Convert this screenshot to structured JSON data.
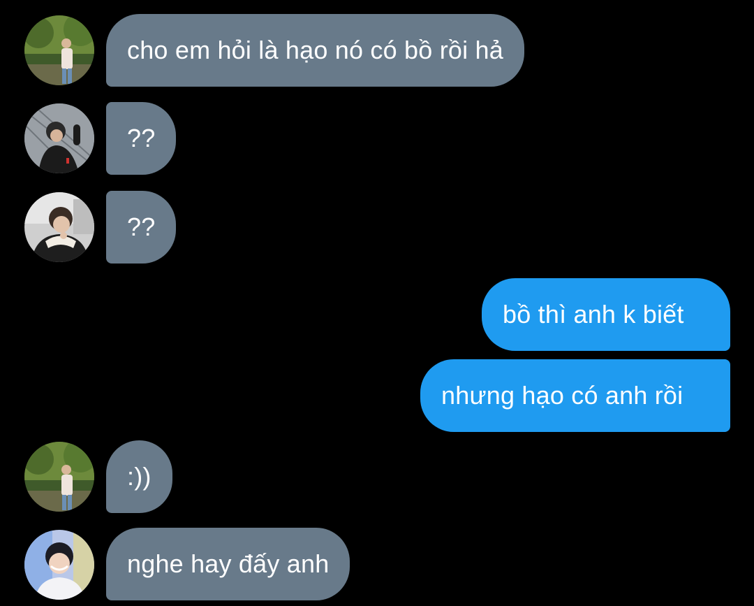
{
  "conversation": {
    "messages": [
      {
        "direction": "incoming",
        "avatar": "avatar-1",
        "text": "cho em hỏi là hạo nó có bồ rồi hả"
      },
      {
        "direction": "incoming",
        "avatar": "avatar-2",
        "text": "??"
      },
      {
        "direction": "incoming",
        "avatar": "avatar-3",
        "text": "??"
      },
      {
        "direction": "outgoing",
        "text": "bồ thì anh k biết"
      },
      {
        "direction": "outgoing",
        "text": "nhưng hạo có anh rồi"
      },
      {
        "direction": "incoming",
        "avatar": "avatar-1",
        "text": ":))"
      },
      {
        "direction": "incoming",
        "avatar": "avatar-4",
        "text": "nghe hay đấy anh"
      }
    ]
  },
  "colors": {
    "background": "#000000",
    "incoming_bubble": "#687a8a",
    "outgoing_bubble": "#1f9bf0",
    "text": "#ffffff"
  }
}
